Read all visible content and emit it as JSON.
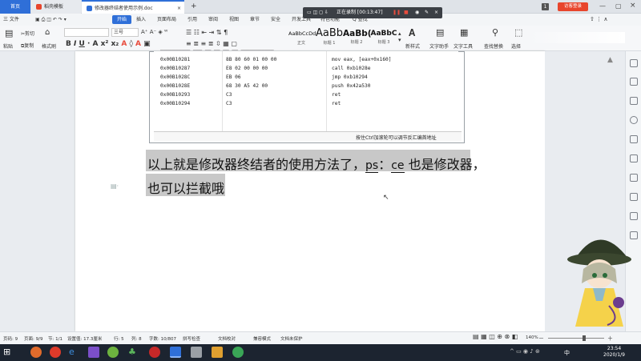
{
  "titlebar": {
    "tab_home": "首页",
    "tab_template": "稻壳模板",
    "tab_doc": "修改器终结者使用示例.doc",
    "add_tab": "+",
    "page_badge": "1",
    "login_label": "访客登录"
  },
  "recorder": {
    "status": "正在录制 [00:13:47]"
  },
  "menu": {
    "file": "三 文件",
    "items": [
      "开始",
      "插入",
      "页面布局",
      "引用",
      "审阅",
      "视图",
      "章节",
      "安全",
      "开发工具",
      "特色功能"
    ],
    "search": "Q 查找"
  },
  "ribbon": {
    "paste": "粘贴",
    "cut": "剪切",
    "copy": "复制",
    "format_painter": "格式刷",
    "font_size": "三号",
    "styles": [
      {
        "sample": "AaBbCcDd",
        "name": "正文"
      },
      {
        "sample": "AaBb",
        "name": "标题 1"
      },
      {
        "sample": "AaBb(",
        "name": "标题 2"
      },
      {
        "sample": "AaBbC",
        "name": "标题 3"
      }
    ],
    "new_style": "新样式",
    "text_assistant": "文字助手",
    "text_tools": "文字工具",
    "find_replace": "查找替换",
    "select": "选择"
  },
  "asm": {
    "rows": [
      {
        "addr": "0x00B10281",
        "bytes": "8B 80 60 01 00 00",
        "instr": "mov eax, [eax+0x160]"
      },
      {
        "addr": "0x00B10287",
        "bytes": "E8 02 00 00 00",
        "instr": "call 0xb1028e"
      },
      {
        "addr": "0x00B1028C",
        "bytes": "EB 06",
        "instr": "jmp 0xb10294"
      },
      {
        "addr": "0x00B1028E",
        "bytes": "68 30 A5 42 00",
        "instr": "push 0x42a530"
      },
      {
        "addr": "0x00B10293",
        "bytes": "C3",
        "instr": "ret"
      },
      {
        "addr": "0x00B10294",
        "bytes": "C3",
        "instr": "ret"
      }
    ],
    "status": "按住Ctrl加滚轮可以调节反汇编首地址"
  },
  "document": {
    "line1_a": "以上就是修改器终结者的使用方法了，",
    "line1_ps": "ps",
    "line1_colon": "：",
    "line1_ce": "ce",
    "line1_b": " 也是修改器，",
    "line2": "也可以拦截哦"
  },
  "statusbar": {
    "page": "页码: 9",
    "pages": "页面: 9/9",
    "section": "节: 1/1",
    "setting": "设置值: 17.3厘米",
    "row": "行: 5",
    "col": "列: 8",
    "words": "字数: 10/807",
    "spell": "拼写检查",
    "proof": "文档校对",
    "compat": "兼容模式",
    "protect": "文档未保护",
    "zoom": "140%"
  },
  "taskbar": {
    "time": "23:54",
    "date": "2020/1/9",
    "ime": "中"
  },
  "colors": {
    "accent": "#2f6fd8",
    "highlight": "#c8c8c8",
    "recorder_bg": "#3b3f45"
  }
}
